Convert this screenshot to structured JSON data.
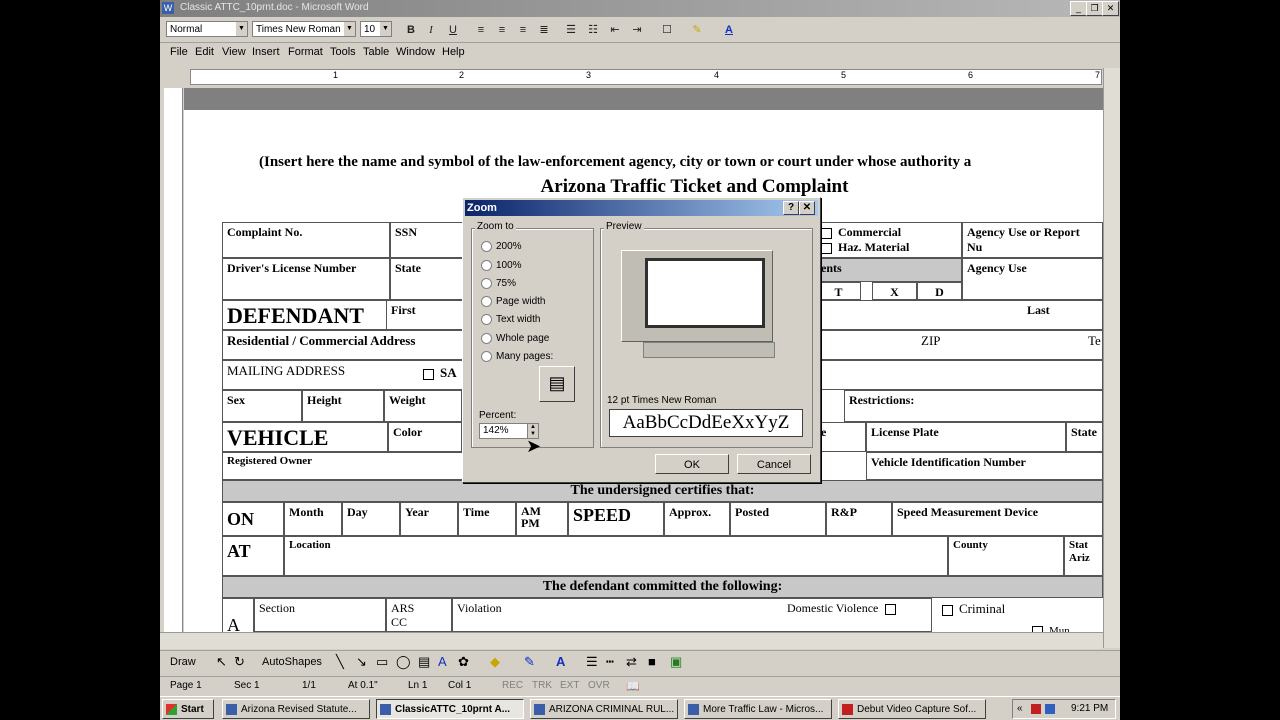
{
  "window": {
    "title": "Classic ATTC_10prnt.doc - Microsoft Word",
    "app_icon": "W",
    "buttons": [
      "_",
      "❐",
      "✕"
    ]
  },
  "formatting_toolbar": {
    "style": "Normal",
    "font": "Times New Roman",
    "size": "10",
    "bold": "B",
    "italic": "I",
    "underline": "U"
  },
  "menu": [
    "File",
    "Edit",
    "View",
    "Insert",
    "Format",
    "Tools",
    "Table",
    "Window",
    "Help"
  ],
  "ruler": {
    "numbers": [
      "1",
      "2",
      "3",
      "4",
      "5",
      "6",
      "7"
    ]
  },
  "form": {
    "insert_line": "(Insert here the name and symbol of the law-enforcement agency, city or town or court under whose authority a",
    "title": "Arizona Traffic Ticket and Complaint",
    "complaint_no": "Complaint No.",
    "ssn": "SSN",
    "commercial": "Commercial",
    "haz_material": "Haz. Material",
    "agency_use_report": "Agency Use or Report Nu",
    "drivers_license": "Driver's License Number",
    "state": "State",
    "ents": "ents",
    "agency_use": "Agency Use",
    "t": "T",
    "x": "X",
    "d": "D",
    "defendant": "DEFENDANT",
    "first": "First",
    "last": "Last",
    "residential": "Residential / Commercial Address",
    "zip": "ZIP",
    "te": "Te",
    "mailing": "MAILING ADDRESS",
    "sa": "SA",
    "sex": "Sex",
    "height": "Height",
    "weight": "Weight",
    "restrictions": "Restrictions:",
    "vehicle": "VEHICLE",
    "color": "Color",
    "e": "e",
    "license_plate": "License Plate",
    "state2": "State",
    "registered_owner": "Registered Owner",
    "vin": "Vehicle Identification Number",
    "certifies": "The undersigned certifies that:",
    "on": "ON",
    "month": "Month",
    "day": "Day",
    "year": "Year",
    "time": "Time",
    "ampm": "AM\nPM",
    "speed": "SPEED",
    "approx": "Approx.",
    "posted": "Posted",
    "rp": "R&P",
    "speed_device": "Speed Measurement Device",
    "at": "AT",
    "location": "Location",
    "county": "County",
    "stat": "Stat\nAriz",
    "committed": "The defendant committed the following:",
    "a": "A",
    "section": "Section",
    "ars": "ARS\nCC",
    "violation": "Violation",
    "domestic": "Domestic Violence",
    "criminal": "Criminal",
    "more": "Mun"
  },
  "zoom_dialog": {
    "title": "Zoom",
    "help": "?",
    "close": "✕",
    "zoom_to": "Zoom to",
    "options": [
      "200%",
      "100%",
      "75%",
      "Page width",
      "Text width",
      "Whole page",
      "Many pages:"
    ],
    "preview": "Preview",
    "font_caption": "12 pt Times New Roman",
    "sample": "AaBbCcDdEeXxYyZ",
    "percent_label": "Percent:",
    "percent_value": "142%",
    "ok": "OK",
    "cancel": "Cancel"
  },
  "draw_toolbar": {
    "draw": "Draw",
    "autoshapes": "AutoShapes"
  },
  "status": {
    "page": "Page 1",
    "sec": "Sec 1",
    "pages": "1/1",
    "at": "At 0.1\"",
    "ln": "Ln 1",
    "col": "Col 1",
    "rec": "REC",
    "trk": "TRK",
    "ext": "EXT",
    "ovr": "OVR"
  },
  "taskbar": {
    "start": "Start",
    "tasks": [
      "Arizona Revised Statute...",
      "ClassicATTC_10prnt A...",
      "ARIZONA CRIMINAL RUL...",
      "More Traffic Law - Micros...",
      "Debut Video Capture Sof..."
    ],
    "clock": "9:21 PM"
  }
}
